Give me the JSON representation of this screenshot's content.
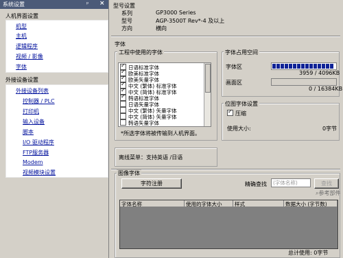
{
  "panel": {
    "title": "系统设置",
    "pin_glyph": "ᵖ",
    "close_glyph": "×",
    "hmi_section": "人机界面设置",
    "hmi_items": [
      "机型",
      "主机",
      "逻辑程序",
      "视频 / 影像",
      "字体"
    ],
    "ext_section": "外接设备设置",
    "ext_list_label": "外接设备列表",
    "ext_items": [
      "控制器 / PLC",
      "打印机",
      "输入设备",
      "脚本",
      "I/O 驱动程序",
      "FTP服务器",
      "Modem",
      "视频模块设置"
    ]
  },
  "model": {
    "heading": "型号设置",
    "rows": [
      {
        "label": "系列",
        "value": "GP3000 Series"
      },
      {
        "label": "型号",
        "value": "AGP-3500T  Rev*-4 及以上"
      },
      {
        "label": "方向",
        "value": "横向"
      }
    ]
  },
  "font": {
    "heading": "字体",
    "used_group": "工程中使用的字体",
    "fonts": [
      {
        "name": "日语标准字体",
        "checked": true
      },
      {
        "name": "欧美标准字体",
        "checked": true
      },
      {
        "name": "欧美矢量字体",
        "checked": true
      },
      {
        "name": "中文 (繁体) 标准字体",
        "checked": true
      },
      {
        "name": "中文 (简体) 标准字体",
        "checked": true
      },
      {
        "name": "韩语标准字体",
        "checked": true
      },
      {
        "name": "日语矢量字体",
        "checked": false
      },
      {
        "name": "中文 (繁体) 矢量字体",
        "checked": false
      },
      {
        "name": "中文 (简体) 矢量字体",
        "checked": false
      },
      {
        "name": "韩语矢量字体",
        "checked": false
      }
    ],
    "note": "*所选字体将被传输到人机界面。",
    "space_group": "字体占用空间",
    "font_area_label": "字体区",
    "font_area_value": "3959 / 4096KB",
    "font_area_fraction": 0.966,
    "screen_area_label": "画面区",
    "screen_area_value": "0 / 16384KB",
    "bitmap_group": "位图字体设置",
    "compress_label": "压缩",
    "compress_checked": true,
    "used_size_label": "使用大小:",
    "used_size_unit": "0字节",
    "offline_text": "离线菜单：支持英语 /日语"
  },
  "image_font": {
    "heading": "图像字体",
    "register_button": "字符注册",
    "search_label": "精确查找",
    "search_placeholder": "(字体名称)",
    "search_button": "查找",
    "ref_label": "参考部件",
    "ref_icon": "⌕",
    "columns": [
      "字体名称",
      "使用的字体大小",
      "样式",
      "数据大小 (字节数)"
    ],
    "total_label": "总计使用: 0字节"
  }
}
